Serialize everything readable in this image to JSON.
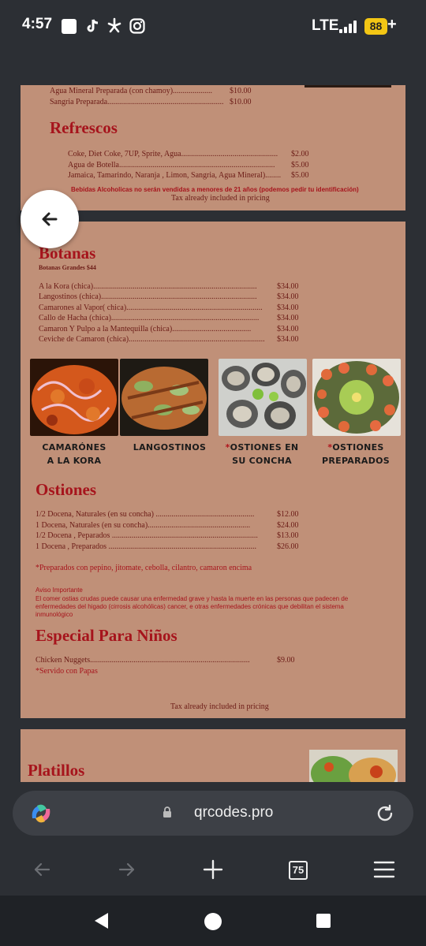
{
  "status_bar": {
    "time": "4:57",
    "network": "LTE",
    "battery": "88",
    "battery_plus": "+",
    "icons": [
      "square-app-icon",
      "tiktok-icon",
      "yelp-icon",
      "instagram-icon",
      "signal-icon",
      "battery-icon"
    ]
  },
  "menu": {
    "drinks_top": [
      {
        "name": "Agua Mineral Preparada (con chamoy)....................",
        "price": "$10.00"
      },
      {
        "name": "Sangria Preparada...........................................................",
        "price": "$10.00"
      }
    ],
    "refrescos": {
      "title": "Refrescos",
      "items": [
        {
          "name": "Coke, Diet Coke, 7UP, Sprite, Agua.................................................",
          "price": "$2.00"
        },
        {
          "name": "Agua de Botella...............................................................................",
          "price": "$5.00"
        },
        {
          "name": "Jamaica, Tamarindo, Naranja , Limon, Sangria, Agua Mineral)........",
          "price": "$5.00"
        }
      ],
      "alcohol_note": "Bebidas Alcoholicas no serán vendidas a menores de 21 años   (podemos pedir tu identificación)",
      "tax": "Tax already included in pricing"
    },
    "botanas": {
      "title": "Botanas",
      "subtitle": "Botanas Grandes $44",
      "items": [
        {
          "name": "A la Kora (chica)...................................................................................",
          "price": "$34.00"
        },
        {
          "name": "Langostinos (chica)...............................................................................",
          "price": "$34.00"
        },
        {
          "name": "Camarones al Vapor( chica).....................................................................",
          "price": "$34.00"
        },
        {
          "name": "Callo de Hacha (chica)...........................................................................",
          "price": "$34.00"
        },
        {
          "name": "Camaron Y Pulpo a la Mantequilla (chica)........................................",
          "price": "$34.00"
        },
        {
          "name": "Ceviche de Camaron (chica).....................................................................",
          "price": "$34.00"
        }
      ]
    },
    "photos": [
      {
        "line1": "CAMARÓNES",
        "line2": "A LA KORA",
        "star": false
      },
      {
        "line1": "LANGOSTINOS",
        "line2": "",
        "star": false
      },
      {
        "line1": "OSTIONES EN",
        "line2": "SU CONCHA",
        "star": true
      },
      {
        "line1": "OSTIONES",
        "line2": "PREPARADOS",
        "star": true
      }
    ],
    "star_mark": "*",
    "ostiones": {
      "title": "Ostiones",
      "items": [
        {
          "name": "1/2 Docena, Naturales (en su concha) ..................................................",
          "price": "$12.00"
        },
        {
          "name": "1 Docena, Naturales (en su concha)....................................................",
          "price": "$24.00"
        },
        {
          "name": "1/2 Docena , Peparados ..........................................................................",
          "price": "$13.00"
        },
        {
          "name": "1 Docena , Preparados ...........................................................................",
          "price": "$26.00"
        }
      ],
      "prep_note": "*Preparados con pepino, jitomate, cebolla, cilantro, camaron encima",
      "warning_title": "Aviso Importante",
      "warning_text": "El comer ostias crudas puede causar una enfermedad grave y hasta la muerte en las personas que padecen de enfermedades del higado (cirrosis alcohólicas) cancer, e otras enfermedades crónicas que debilitan el sistema inmunológico"
    },
    "ninos": {
      "title": "Especial Para Niños",
      "items": [
        {
          "name": "Chicken Nuggets.................................................................................",
          "price": "$9.00"
        }
      ],
      "note": "*Servido con Papas",
      "tax": "Tax already included in pricing"
    },
    "platillos": {
      "title": "Platillos"
    }
  },
  "browser": {
    "url": "qrcodes.pro",
    "tab_count": "75"
  }
}
